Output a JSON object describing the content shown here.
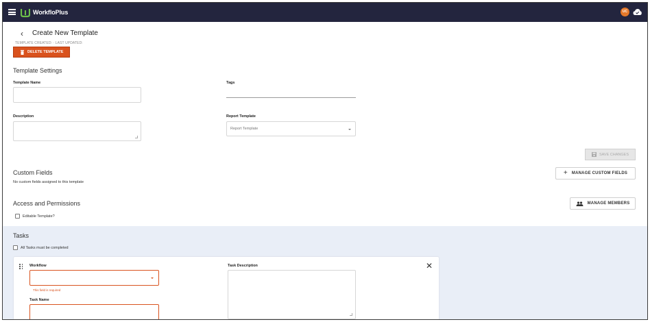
{
  "topbar": {
    "brand": "WorkfloPlus",
    "avatar_initials": "UC",
    "accent_color": "#23253e"
  },
  "header": {
    "title": "Create New Template",
    "meta": "TEMPLATE CREATED:  ·  LAST UPDATED:",
    "delete_label": "DELETE TEMPLATE"
  },
  "settings": {
    "section_title": "Template Settings",
    "template_name_label": "Template Name",
    "template_name_value": "",
    "tags_label": "Tags",
    "tags_value": "",
    "description_label": "Description",
    "description_value": "",
    "report_template_label": "Report Template",
    "report_template_placeholder": "Report Template",
    "save_label": "SAVE CHANGES"
  },
  "custom_fields": {
    "section_title": "Custom Fields",
    "empty_text": "No custom fields assigned to this template",
    "manage_label": "MANAGE CUSTOM FIELDS"
  },
  "access": {
    "section_title": "Access and Permissions",
    "editable_label": "Editable Template?",
    "editable_checked": false,
    "manage_members_label": "MANAGE MEMBERS"
  },
  "tasks": {
    "section_title": "Tasks",
    "all_tasks_label": "All Tasks must be completed",
    "all_tasks_checked": false,
    "card": {
      "workflow_label": "Workflow",
      "workflow_value": "",
      "workflow_error": "This field is required",
      "task_name_label": "Task Name",
      "task_name_value": "",
      "task_description_label": "Task Description",
      "task_description_value": ""
    }
  },
  "colors": {
    "primary_orange": "#d9521d",
    "tasks_background": "#e9eef7"
  }
}
